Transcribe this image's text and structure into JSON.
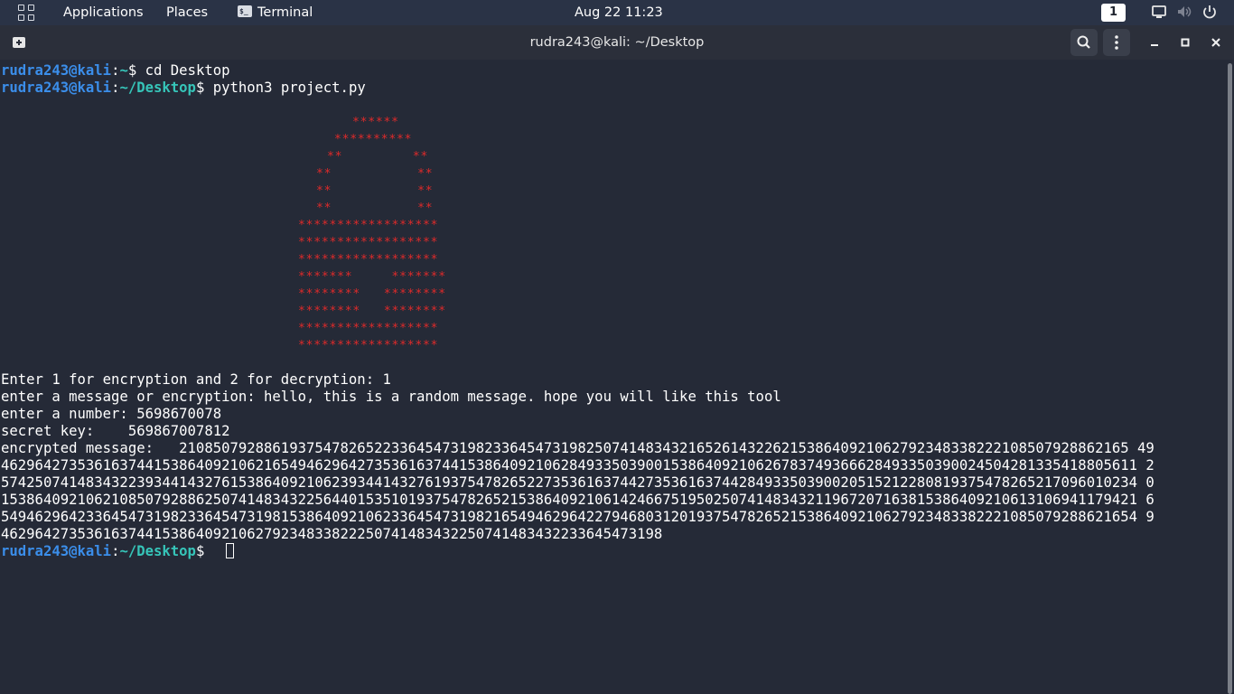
{
  "topbar": {
    "applications": "Applications",
    "places": "Places",
    "terminal": "Terminal",
    "datetime": "Aug 22  11:23",
    "workspace": "1",
    "icons": [
      "apps-grid-icon",
      "terminal-icon",
      "display-icon",
      "volume-muted-icon",
      "power-icon"
    ]
  },
  "window": {
    "title": "rudra243@kali: ~/Desktop",
    "icons": [
      "new-tab-icon",
      "search-icon",
      "menu-kebab-icon",
      "minimize-icon",
      "maximize-icon",
      "close-icon"
    ]
  },
  "terminal": {
    "prompt_user": "rudra243@kali",
    "sep": ":",
    "lines": [
      {
        "path": "~",
        "dollar": "$ ",
        "cmd": "cd Desktop"
      },
      {
        "path": "~/Desktop",
        "dollar": "$ ",
        "cmd": "python3 project.py"
      }
    ],
    "art": [
      "******",
      "**********",
      "**         **",
      "**           **",
      "**           **",
      "**           **",
      "******************",
      "******************",
      "******************",
      "*******     *******",
      "********   ********",
      "********   ********",
      "******************",
      "******************"
    ],
    "output": [
      "Enter 1 for encryption and 2 for decryption: 1",
      "enter a message or encryption: hello, this is a random message. hope you will like this tool",
      "enter a number: 5698670078",
      "secret key:    569867007812",
      "encrypted message:   2108507928861937547826522336454731982336454731982507414834321652614322621538640921062792348338222108507928862165494629642735361637441538640921062165494629642735361637441538640921062849335039001538640921062678374936662849335039002450428133541880561125742507414834322393441432761538640921062393441432761937547826522735361637442735361637442849335039002051521228081937547826521709601023401538640921062108507928862507414834322564401535101937547826521538640921061424667519502507414834321196720716381538640921061310694117942165494629642336454731982336454731981538640921062336454731982165494629642279468031201937547826521538640921062792348338222108507928862165494629642735361637441538640921062792348338222507414834322507414834322336454731 98"
    ],
    "encrypted_lines": [
      "encrypted message:   2108507928861937547826522336454731982336454731982507414834321652614322621538640921062792348338222108507928862165 49",
      "46296427353616374415386409210621654946296427353616374415386409210628493350390015386409210626783749366628493350390024504281335418805611 2",
      "57425074148343223934414327615386409210623934414327619375478265227353616374427353616374428493350390020515212280819375478265217096010234 0",
      "15386409210621085079288625074148343225644015351019375478265215386409210614246675195025074148343211967207163815386409210613106941179421 6",
      "54946296423364547319823364547319815386409210623364547319821654946296422794680312019375478265215386409210627923483382221085079288621654 9",
      "462964273536163744153864092106279234833822250741483432250741483432233645473198"
    ],
    "final_path": "~/Desktop",
    "final_dollar": "$ "
  }
}
